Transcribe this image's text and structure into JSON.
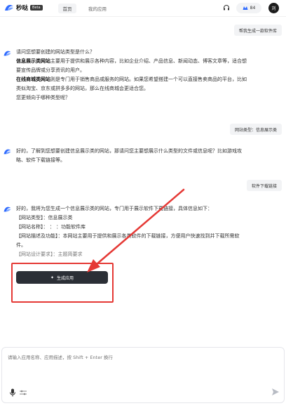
{
  "header": {
    "logo_name": "秒哒",
    "logo_badge": "Beta",
    "nav_home": "首页",
    "nav_apps": "我的应用",
    "credits": "84",
    "avatar_initial": "刘"
  },
  "conversation": {
    "user_msg_1": "帮我生成一款软件库",
    "bot_msg_1": {
      "q": "请问您想要创建的网站类型是什么？",
      "line1_bold": "信息展示类网站",
      "line1_rest": "主要用于提供和展示各种内容，比如企业介绍、产品信息、新闻动态、博客文章等，适合想",
      "line2": "要宣传品牌或分享资讯的用户。",
      "line3_bold": "在线商城类网站",
      "line3_rest": "则是专门用于销售商品或服务的网站。如果您希望搭建一个可以直接售卖商品的平台，比如",
      "line4": "类似淘宝、京东或拼多多的网站，那么在线商城会更适合您。",
      "line5": "您更倾向于哪种类型呢？"
    },
    "user_msg_2": "网站类型：信息展示类",
    "bot_msg_2": {
      "line1": "好的，了解到您想要创建信息展示类的网站，那请问您主要想展示什么类型的文件或信息呢？比如游戏攻",
      "line2": "略、软件下载链接等。"
    },
    "user_msg_3": "软件下载链接",
    "bot_msg_3": {
      "line1": "好的，我将为您生成一个信息展示类的网站，专门用于展示软件下载链接，具体信息如下：",
      "line2": "【网站类型】：信息展示类",
      "line3": "【网站名称】：  ：  ：功能软件库",
      "line4": "【网站描述及功能】：本网站主要用于提供和展示各类软件的下载链接，方便用户快速找到并下载所需软",
      "line5": "件。",
      "line6": "【网站设计要求】：主题简要求"
    },
    "generate_button": "生成应用"
  },
  "composer": {
    "placeholder": "请输入应用名称、应用描述，按 Shift + Enter 换行"
  },
  "colors": {
    "accent_red": "#e53935",
    "button_dark": "#2b2f36",
    "bubble_bg": "#f2f3f5"
  }
}
